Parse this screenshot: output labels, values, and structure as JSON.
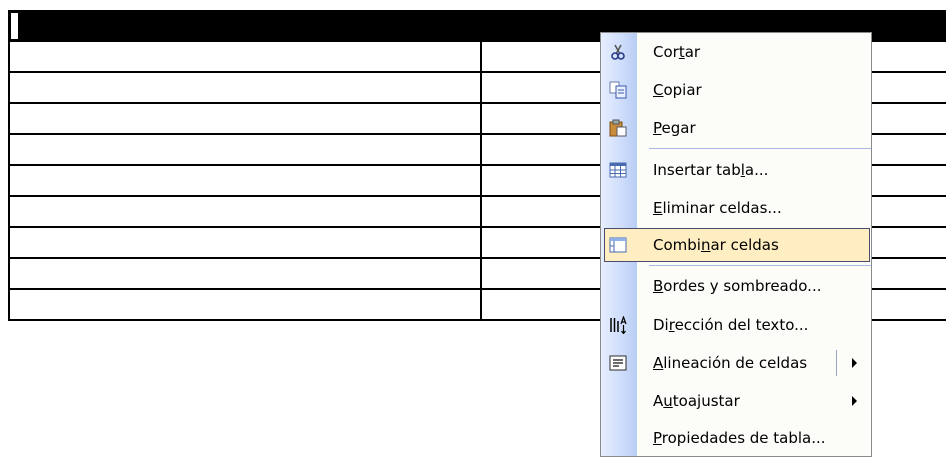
{
  "table": {
    "rows": 9,
    "columns": 2,
    "header_selected": true
  },
  "context_menu": {
    "items": [
      {
        "label_pre": "Cor",
        "label_key": "t",
        "label_post": "ar",
        "icon": "scissors-icon",
        "highlighted": false
      },
      {
        "label_pre": "",
        "label_key": "C",
        "label_post": "opiar",
        "icon": "copy-icon",
        "highlighted": false
      },
      {
        "label_pre": "",
        "label_key": "P",
        "label_post": "egar",
        "icon": "paste-icon",
        "highlighted": false
      },
      {
        "label_pre": "Insertar tab",
        "label_key": "l",
        "label_post": "a...",
        "icon": "insert-table-icon",
        "highlighted": false
      },
      {
        "label_pre": "",
        "label_key": "E",
        "label_post": "liminar celdas...",
        "icon": "",
        "highlighted": false
      },
      {
        "label_pre": "Combi",
        "label_key": "n",
        "label_post": "ar celdas",
        "icon": "merge-cells-icon",
        "highlighted": true
      },
      {
        "label_pre": "",
        "label_key": "B",
        "label_post": "ordes y sombreado...",
        "icon": "",
        "highlighted": false
      },
      {
        "label_pre": "Di",
        "label_key": "r",
        "label_post": "ección del texto...",
        "icon": "text-direction-icon",
        "highlighted": false
      },
      {
        "label_pre": "",
        "label_key": "A",
        "label_post": "lineación de celdas",
        "icon": "cell-alignment-icon",
        "highlighted": false,
        "submenu": true,
        "split": true
      },
      {
        "label_pre": "A",
        "label_key": "u",
        "label_post": "toajustar",
        "icon": "",
        "highlighted": false,
        "submenu": true
      },
      {
        "label_pre": "",
        "label_key": "P",
        "label_post": "ropiedades de tabla...",
        "icon": "",
        "highlighted": false
      }
    ]
  }
}
